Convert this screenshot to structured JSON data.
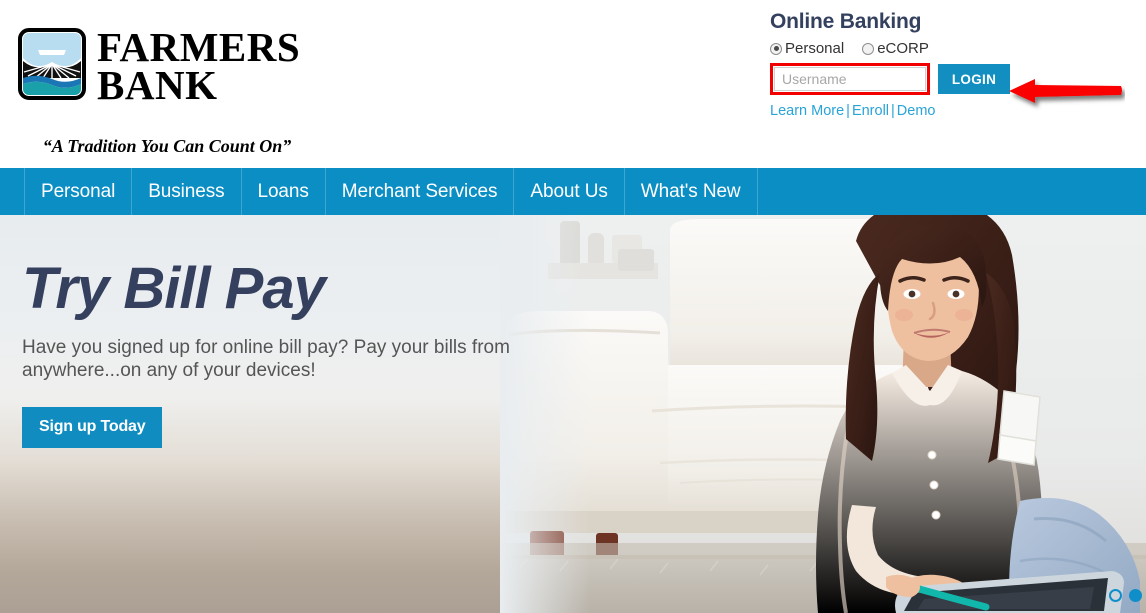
{
  "brand": {
    "name_line_1": "FARMERS",
    "name_line_2": "BANK",
    "tagline": "“A Tradition You Can Count On”",
    "logo_icon": "farm-field-water-logo"
  },
  "online_banking": {
    "title": "Online Banking",
    "account_types": [
      {
        "label": "Personal",
        "selected": true
      },
      {
        "label": "eCORP",
        "selected": false
      }
    ],
    "username": {
      "value": "",
      "placeholder": "Username"
    },
    "login_label": "LOGIN",
    "links": [
      {
        "label": "Learn More"
      },
      {
        "label": "Enroll"
      },
      {
        "label": "Demo"
      }
    ],
    "link_separator": "|",
    "annotation": {
      "type": "red-arrow",
      "points_to": "login-button",
      "color": "#f20000"
    },
    "highlight_color": "#f20000"
  },
  "nav": {
    "items": [
      {
        "label": "Personal"
      },
      {
        "label": "Business"
      },
      {
        "label": "Loans"
      },
      {
        "label": "Merchant Services"
      },
      {
        "label": "About Us"
      },
      {
        "label": "What's New"
      }
    ],
    "background_color": "#0b8ec4"
  },
  "hero": {
    "title": "Try Bill Pay",
    "subtitle": "Have you signed up for online bill pay? Pay your bills from anywhere...on any of your devices!",
    "cta_label": "Sign up Today",
    "cta_color": "#118cc0",
    "title_color": "#35405f",
    "image_alt": "woman-with-tablet-on-floor",
    "carousel": {
      "total": 2,
      "active_index": 1
    }
  }
}
